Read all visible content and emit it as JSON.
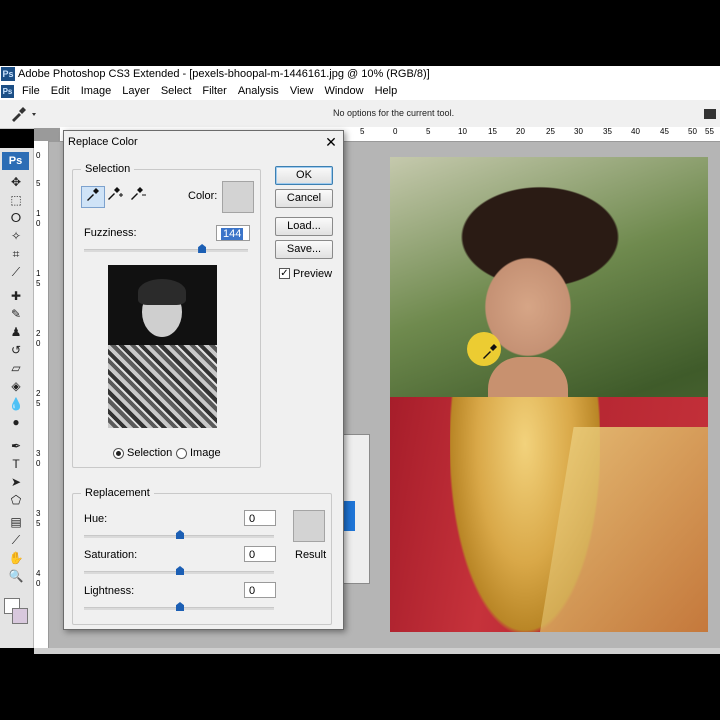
{
  "window": {
    "title": "Adobe Photoshop CS3 Extended - [pexels-bhoopal-m-1446161.jpg @ 10% (RGB/8)]",
    "app_icon": "Ps"
  },
  "menu": [
    "File",
    "Edit",
    "Image",
    "Layer",
    "Select",
    "Filter",
    "Analysis",
    "View",
    "Window",
    "Help"
  ],
  "options_bar": {
    "message": "No options for the current tool."
  },
  "toolbox": {
    "logo": "Ps"
  },
  "ruler": {
    "top_labels": [
      "5",
      "0",
      "5",
      "10",
      "15",
      "20",
      "25",
      "30",
      "35",
      "40",
      "45",
      "50",
      "55"
    ],
    "left_labels": [
      "0",
      "5",
      "1",
      "0",
      "1",
      "5",
      "2",
      "0",
      "2",
      "5",
      "3",
      "0",
      "3",
      "5",
      "4",
      "0"
    ]
  },
  "dialog": {
    "title": "Replace Color",
    "selection": {
      "legend": "Selection",
      "color_label": "Color:",
      "color_value": "#d3d3d3",
      "fuzziness_label": "Fuzziness:",
      "fuzziness_value": "144",
      "fuzziness_fraction": 0.72,
      "view_options": [
        {
          "label": "Selection",
          "checked": true
        },
        {
          "label": "Image",
          "checked": false
        }
      ]
    },
    "replacement": {
      "legend": "Replacement",
      "hue_label": "Hue:",
      "hue_value": "0",
      "saturation_label": "Saturation:",
      "saturation_value": "0",
      "lightness_label": "Lightness:",
      "lightness_value": "0",
      "result_label": "Result",
      "result_color": "#d3d3d3"
    },
    "buttons": {
      "ok": "OK",
      "cancel": "Cancel",
      "load": "Load...",
      "save": "Save..."
    },
    "preview": {
      "label": "Preview",
      "checked": true
    }
  },
  "colors": {
    "accent": "#1c5fb4",
    "sample_highlight": "#f3d131"
  }
}
